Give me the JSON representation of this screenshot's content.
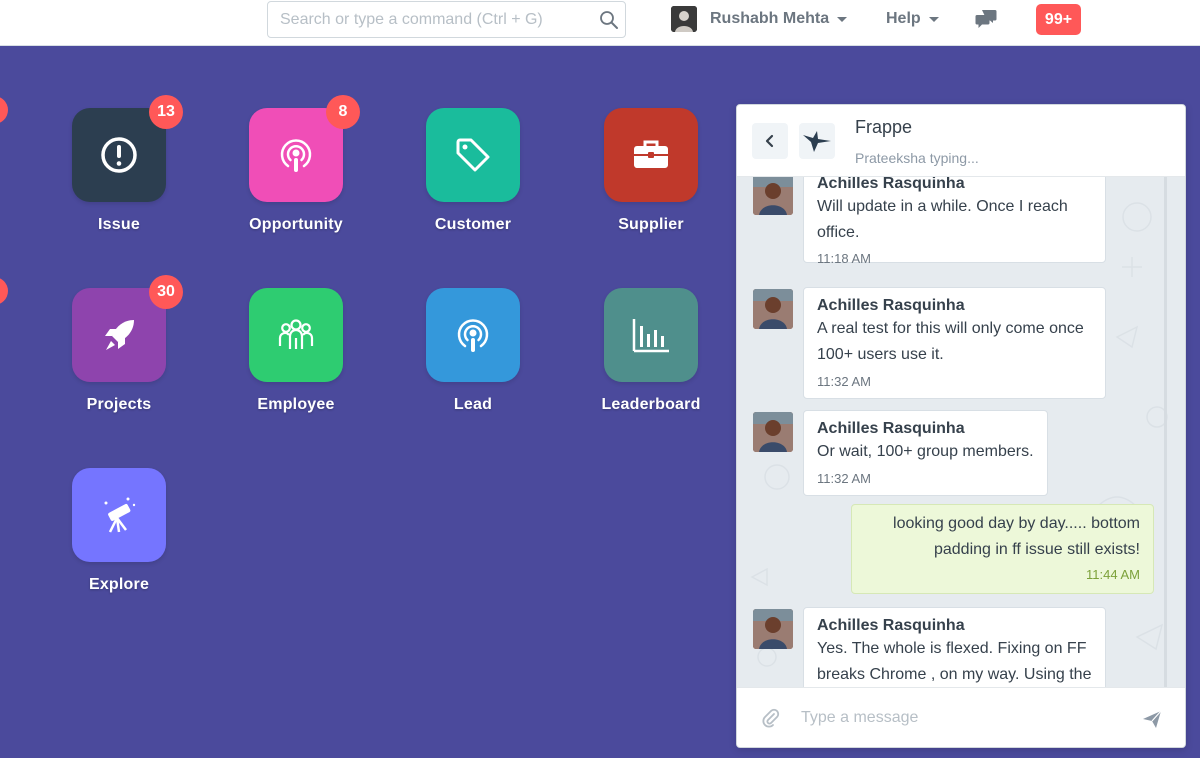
{
  "navbar": {
    "search_placeholder": "Search or type a command (Ctrl + G)",
    "user_name": "Rushabh Mehta",
    "help_label": "Help",
    "notifications_count": "99+",
    "icons": [
      "search-icon",
      "chevron-down-icon",
      "chat-icon"
    ]
  },
  "modules": [
    {
      "label": "Issue",
      "color": "#2c3e50",
      "icon": "exclamation-circle-icon",
      "count": "13"
    },
    {
      "label": "Opportunity",
      "color": "#f04eb7",
      "icon": "podcast-icon",
      "count": "8"
    },
    {
      "label": "Customer",
      "color": "#1abc9c",
      "icon": "tag-icon",
      "count": null
    },
    {
      "label": "Supplier",
      "color": "#c0392b",
      "icon": "briefcase-icon",
      "count": null
    },
    {
      "label": "Projects",
      "color": "#8e44ad",
      "icon": "rocket-icon",
      "count": "30"
    },
    {
      "label": "Employee",
      "color": "#2ecc71",
      "icon": "users-icon",
      "count": null
    },
    {
      "label": "Lead",
      "color": "#3498db",
      "icon": "podcast-icon",
      "count": null
    },
    {
      "label": "Leaderboard",
      "color": "#4f8f8c",
      "icon": "bar-chart-icon",
      "count": null
    },
    {
      "label": "Explore",
      "color": "#7575ff",
      "icon": "telescope-icon",
      "count": null
    }
  ],
  "chat": {
    "room_name": "Frappe",
    "status": "Prateeksha typing...",
    "input_placeholder": "Type a message",
    "messages": [
      {
        "sender": "Achilles Rasquinha",
        "lines": [
          "Will update in a while. Once I reach",
          "office."
        ],
        "time": "11:18 AM",
        "mine": false
      },
      {
        "sender": "Achilles Rasquinha",
        "lines": [
          "A real test for this will only come once",
          "100+ users use it."
        ],
        "time": "11:32 AM",
        "mine": false
      },
      {
        "sender": "Achilles Rasquinha",
        "lines": [
          "Or wait, 100+ group members."
        ],
        "time": "11:32 AM",
        "mine": false
      },
      {
        "sender": "",
        "lines": [
          "looking good day by day..... bottom",
          "padding in ff issue still exists!"
        ],
        "time": "11:44 AM",
        "mine": true
      },
      {
        "sender": "Achilles Rasquinha",
        "lines": [
          "Yes. The whole is flexed. Fixing on FF",
          "breaks Chrome , on my way. Using the"
        ],
        "time": "",
        "mine": false
      }
    ]
  },
  "colors": {
    "background": "#4b4a9c",
    "badge": "#ff5858",
    "own_message": "#edf8d9"
  }
}
